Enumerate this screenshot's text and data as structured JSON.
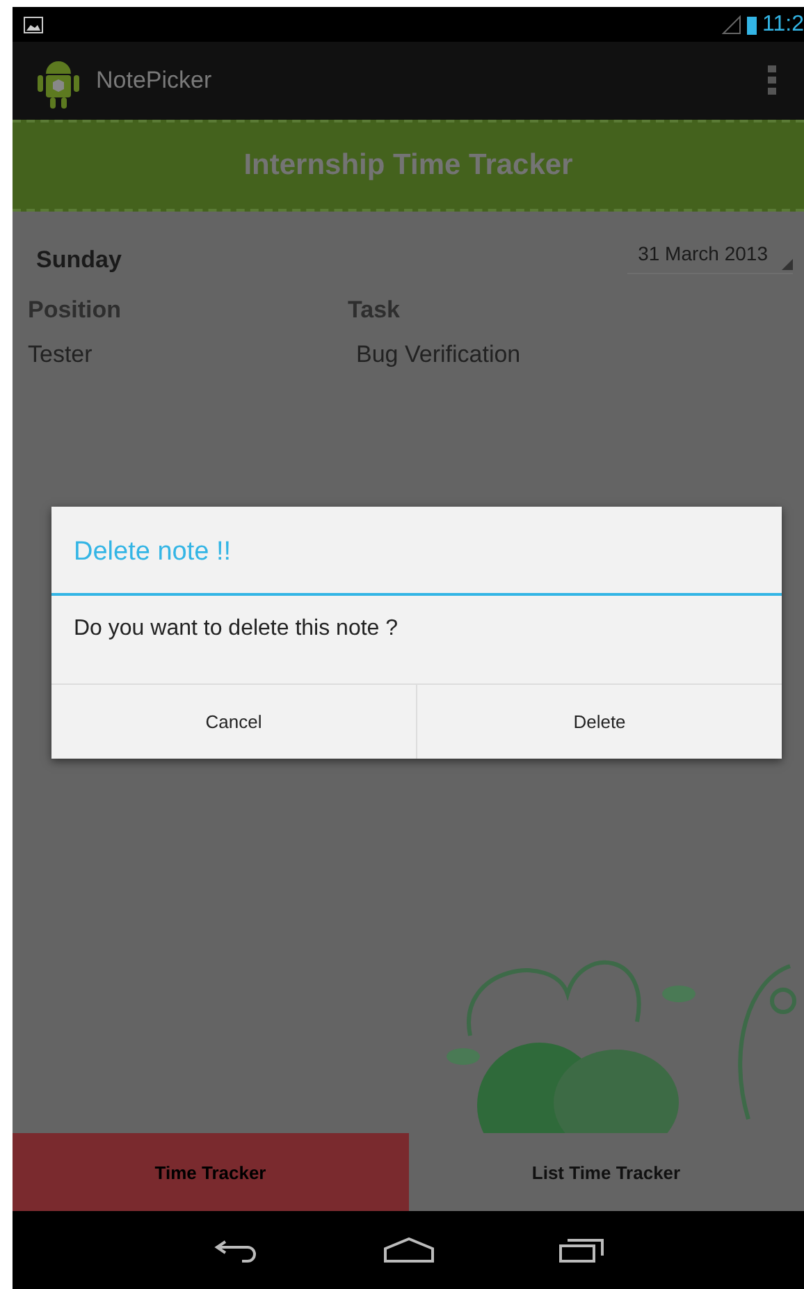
{
  "status_bar": {
    "time": "11:2"
  },
  "app_bar": {
    "title": "NotePicker"
  },
  "header": {
    "title": "Internship Time Tracker"
  },
  "day": "Sunday",
  "date": "31 March 2013",
  "columns": [
    {
      "heading": "Position",
      "value": "Tester"
    },
    {
      "heading": "Task",
      "value": "Bug Verification"
    }
  ],
  "dialog": {
    "title": "Delete note !!",
    "message": "Do you want to delete this note ?",
    "buttons": [
      "Cancel",
      "Delete"
    ]
  },
  "tabs": [
    {
      "label": "Time Tracker",
      "selected": true
    },
    {
      "label": "List Time Tracker",
      "selected": false
    }
  ]
}
